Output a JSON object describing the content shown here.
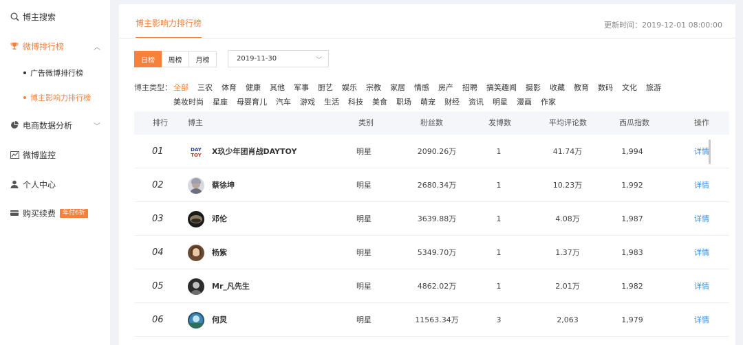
{
  "sidebar": {
    "search": "博主搜索",
    "weibo_rank": "微博排行榜",
    "sub_ad": "广告微博排行榜",
    "sub_influence": "博主影响力排行榜",
    "ecommerce": "电商数据分析",
    "monitor": "微博监控",
    "personal": "个人中心",
    "purchase": "购买续费",
    "promo_badge": "年付6折"
  },
  "header": {
    "title": "博主影响力排行榜",
    "update_time": "更新时间：2019-12-01 08:00:00"
  },
  "filters": {
    "tabs": [
      "日榜",
      "周榜",
      "月榜"
    ],
    "active_tab": "日榜",
    "date": "2019-11-30",
    "category_label": "博主类型：",
    "categories_row1": [
      "全部",
      "三农",
      "体育",
      "健康",
      "其他",
      "军事",
      "厨艺",
      "娱乐",
      "宗教",
      "家居",
      "情感",
      "房产",
      "招聘",
      "搞笑趣闻",
      "摄影",
      "收藏",
      "教育",
      "数码",
      "文化",
      "旅游"
    ],
    "categories_row2": [
      "美妆时尚",
      "星座",
      "母婴育儿",
      "汽车",
      "游戏",
      "生活",
      "科技",
      "美食",
      "职场",
      "萌宠",
      "财经",
      "资讯",
      "明星",
      "漫画",
      "作家"
    ]
  },
  "table": {
    "headers": [
      "排行",
      "博主",
      "类别",
      "粉丝数",
      "发博数",
      "平均评论数",
      "西瓜指数",
      "操作"
    ],
    "rows": [
      {
        "rank": "01",
        "name": "X玖少年团肖战DAYTOY",
        "category": "明星",
        "fans": "2090.26万",
        "posts": "1",
        "avg_comments": "41.74万",
        "index": "1,994",
        "action": "详情",
        "avatar_text": "DAY TOY"
      },
      {
        "rank": "02",
        "name": "蔡徐坤",
        "category": "明星",
        "fans": "2680.34万",
        "posts": "1",
        "avg_comments": "10.23万",
        "index": "1,992",
        "action": "详情"
      },
      {
        "rank": "03",
        "name": "邓伦",
        "category": "明星",
        "fans": "3639.88万",
        "posts": "1",
        "avg_comments": "4.08万",
        "index": "1,987",
        "action": "详情"
      },
      {
        "rank": "04",
        "name": "杨紫",
        "category": "明星",
        "fans": "5349.70万",
        "posts": "1",
        "avg_comments": "1.37万",
        "index": "1,983",
        "action": "详情"
      },
      {
        "rank": "05",
        "name": "Mr_凡先生",
        "category": "明星",
        "fans": "4862.02万",
        "posts": "1",
        "avg_comments": "2.01万",
        "index": "1,982",
        "action": "详情"
      },
      {
        "rank": "06",
        "name": "何炅",
        "category": "明星",
        "fans": "11563.34万",
        "posts": "3",
        "avg_comments": "2,063",
        "index": "1,979",
        "action": "详情"
      }
    ]
  },
  "colors": {
    "accent": "#f5813d",
    "link": "#3b8fe4"
  }
}
